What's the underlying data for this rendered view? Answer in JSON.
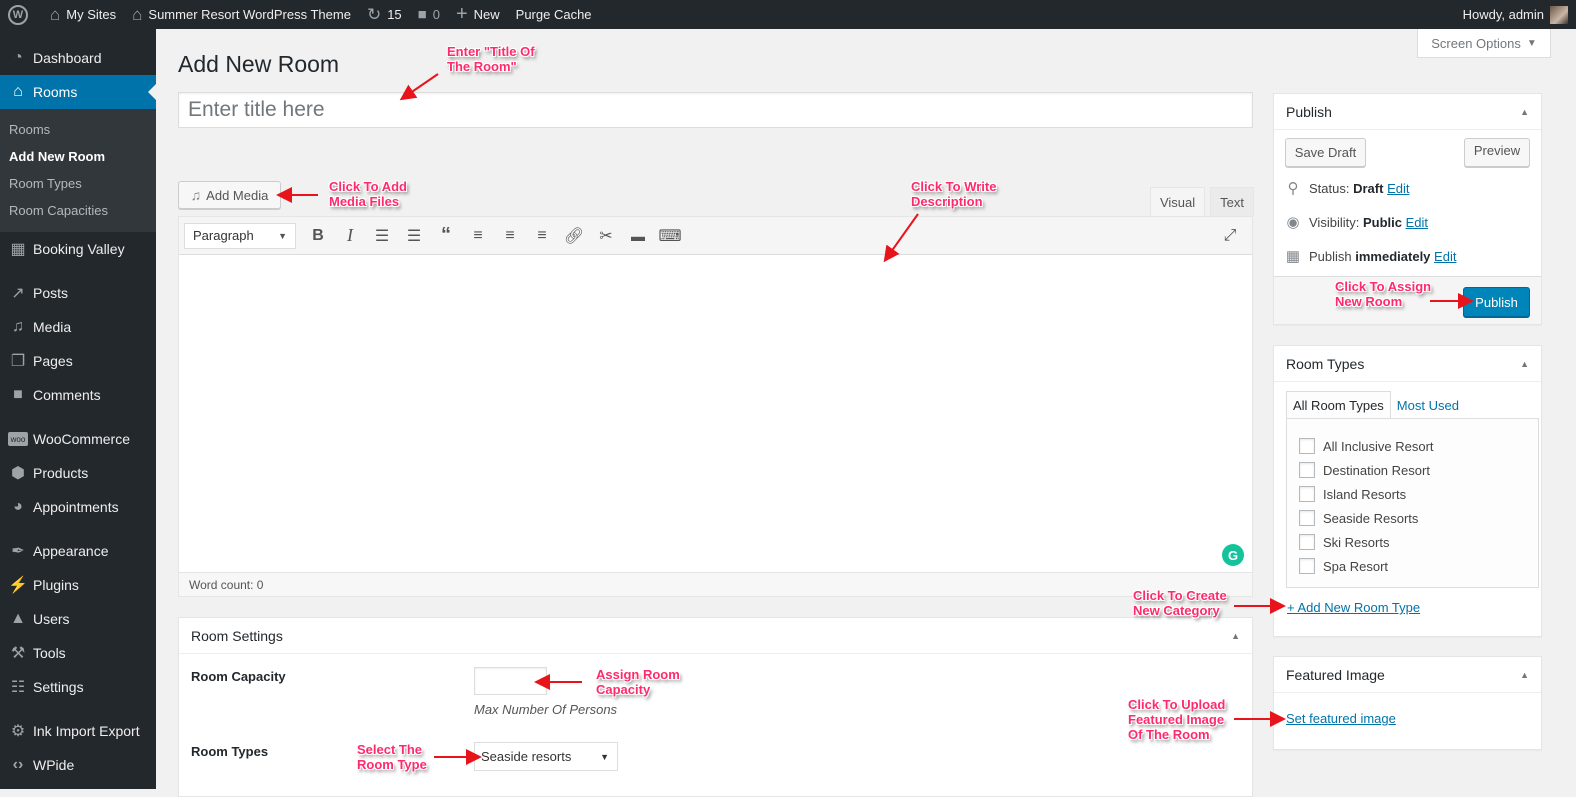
{
  "admin_bar": {
    "wp_logo_icon": "wordpress-logo-icon",
    "my_sites": "My Sites",
    "site_name": "Summer Resort WordPress Theme",
    "updates_count": "15",
    "comments_count": "0",
    "new_label": "New",
    "purge_cache": "Purge Cache",
    "howdy": "Howdy, admin"
  },
  "sidebar": {
    "items": [
      {
        "label": "Dashboard",
        "icon": "dashboard-icon"
      },
      {
        "label": "Rooms",
        "icon": "home-icon",
        "current": true
      },
      {
        "label": "Booking Valley",
        "icon": "calendar-icon"
      },
      {
        "label": "Posts",
        "icon": "pin-icon"
      },
      {
        "label": "Media",
        "icon": "media-icon"
      },
      {
        "label": "Pages",
        "icon": "pages-icon"
      },
      {
        "label": "Comments",
        "icon": "comment-icon"
      },
      {
        "label": "WooCommerce",
        "icon": "woo-icon"
      },
      {
        "label": "Products",
        "icon": "box-icon"
      },
      {
        "label": "Appointments",
        "icon": "appointments-icon"
      },
      {
        "label": "Appearance",
        "icon": "brush-icon"
      },
      {
        "label": "Plugins",
        "icon": "plug-icon"
      },
      {
        "label": "Users",
        "icon": "user-icon"
      },
      {
        "label": "Tools",
        "icon": "wrench-icon"
      },
      {
        "label": "Settings",
        "icon": "settings-icon"
      },
      {
        "label": "Ink Import Export",
        "icon": "gear-icon"
      },
      {
        "label": "WPide",
        "icon": "code-icon"
      }
    ],
    "submenu": [
      {
        "label": "Rooms"
      },
      {
        "label": "Add New Room",
        "active": true
      },
      {
        "label": "Room Types"
      },
      {
        "label": "Room Capacities"
      }
    ]
  },
  "screen_options": "Screen Options",
  "page_title": "Add New Room",
  "title_input": {
    "placeholder": "Enter title here",
    "value": ""
  },
  "editor": {
    "add_media": "Add Media",
    "tabs": [
      "Visual",
      "Text"
    ],
    "active_tab": "Visual",
    "format": "Paragraph",
    "word_count": "Word count: 0"
  },
  "room_settings": {
    "title": "Room Settings",
    "capacity_label": "Room Capacity",
    "capacity_value": "",
    "capacity_hint": "Max Number Of Persons",
    "types_label": "Room Types",
    "types_selected": "Seaside resorts"
  },
  "publish": {
    "title": "Publish",
    "save_draft": "Save Draft",
    "preview": "Preview",
    "status_label": "Status:",
    "status_value": "Draft",
    "visibility_label": "Visibility:",
    "visibility_value": "Public",
    "publish_label": "Publish",
    "publish_value": "immediately",
    "edit": "Edit",
    "publish_button": "Publish"
  },
  "room_types_box": {
    "title": "Room Types",
    "tabs": [
      "All Room Types",
      "Most Used"
    ],
    "items": [
      "All Inclusive Resort",
      "Destination Resort",
      "Island Resorts",
      "Seaside Resorts",
      "Ski Resorts",
      "Spa Resort"
    ],
    "add_new": "+ Add New Room Type"
  },
  "featured_image": {
    "title": "Featured Image",
    "set_link": "Set featured image"
  },
  "annotations": {
    "title": "Enter \"Title Of\nThe Room\"",
    "add_media": "Click To Add\nMedia Files",
    "description": "Click To Write\nDescription",
    "publish": "Click To Assign\nNew Room",
    "new_category": "Click To Create\nNew Category",
    "capacity": "Assign Room\nCapacity",
    "room_type": "Select The\nRoom Type",
    "featured": "Click To Upload\nFeatured Image\nOf The Room"
  },
  "colors": {
    "admin_dark": "#23282d",
    "accent": "#0073aa",
    "publish_button": "#0085ba",
    "annotation": "#ff2a6d",
    "arrow": "#e8141c"
  }
}
